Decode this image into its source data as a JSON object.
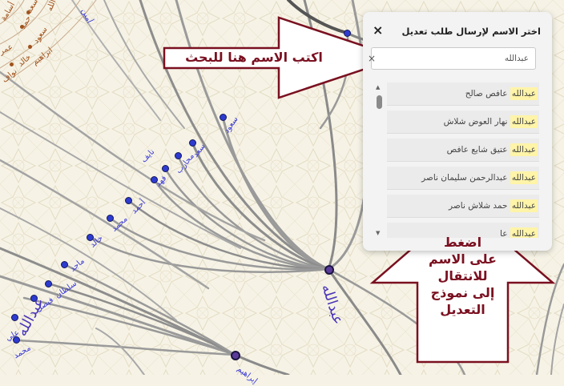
{
  "panel": {
    "title": "اختر الاسم لإرسال طلب تعديل",
    "close_label": "×",
    "search_value": "عبدالله",
    "search_clear": "×",
    "scroll_up": "▲",
    "scroll_down": "▼",
    "results": [
      {
        "highlight": "عبدالله",
        "rest": " عافص صالح"
      },
      {
        "highlight": "عبدالله",
        "rest": " نهار العوض شلاش"
      },
      {
        "highlight": "عبدالله",
        "rest": " عتيق شايع عافص"
      },
      {
        "highlight": "عبدالله",
        "rest": " عبدالرحمن سليمان ناصر"
      },
      {
        "highlight": "عبدالله",
        "rest": " حمد شلاش ناصر"
      },
      {
        "highlight": "عبدالله",
        "rest": " عا"
      }
    ]
  },
  "callouts": {
    "search_hint": "اكتب الاسم هنا للبحث",
    "click_hint_lines": [
      "اضغط",
      "على الاسم",
      "للانتقال",
      "إلى نموذج",
      "التعديل"
    ]
  },
  "tree": {
    "labels": {
      "abdullah_main": "عبدالله",
      "abdullah_left": "عبدالله",
      "saud": "سعود",
      "saad": "سعد",
      "muharib": "محارب",
      "nayef": "نايف",
      "fahad": "فهد",
      "ahmad": "أحمد",
      "mohammad1": "محمد",
      "khalid": "خالد",
      "majid": "ماجد",
      "sultan": "سلطان",
      "faisal": "فيصل",
      "ali": "علي",
      "mohammad2": "محمد",
      "ibrahim": "إبراهيم",
      "amin": "أمين",
      "ibrahim_b": "ابراهيم",
      "saad_b": "سعد",
      "hamad_b": "حمد",
      "osama_b": "أسامة",
      "omar_b": "عمر",
      "saud_b": "سعود",
      "khalid_b": "خالد",
      "nawaf_b": "نواف",
      "abdullah_b": "عبدالله"
    }
  }
}
